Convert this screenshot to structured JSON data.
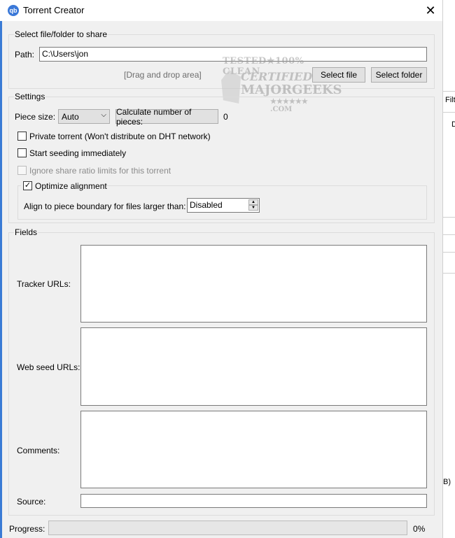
{
  "window": {
    "title": "Torrent Creator",
    "app_icon": "qb",
    "close_glyph": "✕"
  },
  "background_window": {
    "text_fragments": [
      "Filt",
      "D",
      "B)"
    ]
  },
  "share": {
    "group_title": "Select file/folder to share",
    "path_label": "Path:",
    "path_value": "C:\\Users\\jon",
    "drag_drop_text": "[Drag and drop area]",
    "select_file_label": "Select file",
    "select_folder_label": "Select folder"
  },
  "watermark": {
    "line1": "TESTED★100% CLEAN",
    "line2": "CERTIFIED",
    "line3": "MAJORGEEKS",
    "line4": "★★★★★★ .COM"
  },
  "settings": {
    "group_title": "Settings",
    "piece_size_label": "Piece size:",
    "piece_size_value": "Auto",
    "calc_button_label": "Calculate number of pieces:",
    "pieces_count": "0",
    "private_label": "Private torrent (Won't distribute on DHT network)",
    "private_checked": false,
    "seed_label": "Start seeding immediately",
    "seed_checked": false,
    "ignore_ratio_label": "Ignore share ratio limits for this torrent",
    "ignore_ratio_checked": false,
    "optimize_label": "Optimize alignment",
    "optimize_checked": true,
    "align_label": "Align to piece boundary for files larger than:",
    "align_value": "Disabled"
  },
  "fields": {
    "group_title": "Fields",
    "tracker_label": "Tracker URLs:",
    "webseed_label": "Web seed URLs:",
    "comments_label": "Comments:",
    "source_label": "Source:"
  },
  "progress": {
    "label": "Progress:",
    "value_text": "0%",
    "value": 0
  }
}
